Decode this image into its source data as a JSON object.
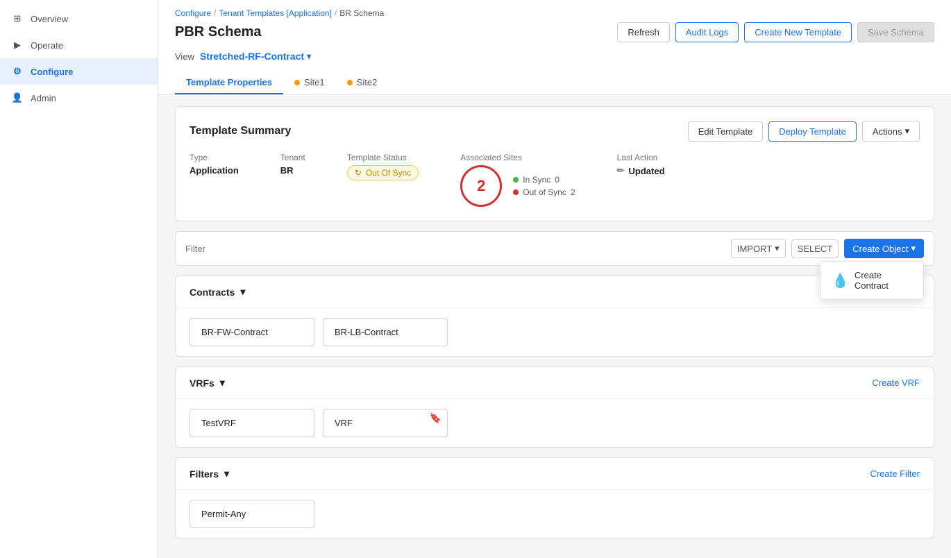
{
  "sidebar": {
    "items": [
      {
        "id": "overview",
        "label": "Overview",
        "icon": "⊞",
        "active": false
      },
      {
        "id": "operate",
        "label": "Operate",
        "icon": "▶",
        "active": false
      },
      {
        "id": "configure",
        "label": "Configure",
        "icon": "⚙",
        "active": true
      },
      {
        "id": "admin",
        "label": "Admin",
        "icon": "👤",
        "active": false
      }
    ]
  },
  "breadcrumb": {
    "items": [
      "Configure",
      "Tenant Templates [Application]",
      "BR Schema"
    ],
    "separators": [
      "/",
      "/"
    ]
  },
  "header": {
    "title": "PBR Schema",
    "buttons": {
      "refresh": "Refresh",
      "audit_logs": "Audit Logs",
      "create_new_template": "Create New Template",
      "save_schema": "Save Schema"
    }
  },
  "view": {
    "label": "View",
    "selected": "Stretched-RF-Contract"
  },
  "tabs": [
    {
      "id": "template-properties",
      "label": "Template Properties",
      "dot": null,
      "active": true
    },
    {
      "id": "site1",
      "label": "Site1",
      "dot": "#ff9800",
      "active": false
    },
    {
      "id": "site2",
      "label": "Site2",
      "dot": "#ff9800",
      "active": false
    }
  ],
  "template_summary": {
    "title": "Template Summary",
    "buttons": {
      "edit_template": "Edit Template",
      "deploy_template": "Deploy Template",
      "actions": "Actions"
    },
    "fields": {
      "type": {
        "label": "Type",
        "value": "Application"
      },
      "tenant": {
        "label": "Tenant",
        "value": "BR"
      },
      "template_status": {
        "label": "Template Status",
        "value": "Out Of Sync",
        "badge_style": "warning"
      },
      "associated_sites": {
        "label": "Associated Sites",
        "count": 2,
        "in_sync": {
          "label": "In Sync",
          "count": 0,
          "color": "#4caf50"
        },
        "out_of_sync": {
          "label": "Out of Sync",
          "count": 2,
          "color": "#d32f2f"
        }
      },
      "last_action": {
        "label": "Last Action",
        "value": "Updated"
      }
    }
  },
  "filter": {
    "placeholder": "Filter",
    "import_label": "IMPORT",
    "select_label": "SELECT",
    "create_object_label": "Create Object"
  },
  "dropdown_menu": {
    "items": [
      {
        "label": "Create Contract",
        "icon": "💧"
      }
    ]
  },
  "sections": [
    {
      "id": "contracts",
      "title": "Contracts",
      "action": "Create Contract",
      "items": [
        {
          "label": "BR-FW-Contract",
          "bookmark": false
        },
        {
          "label": "BR-LB-Contract",
          "bookmark": false
        }
      ]
    },
    {
      "id": "vrfs",
      "title": "VRFs",
      "action": "Create VRF",
      "items": [
        {
          "label": "TestVRF",
          "bookmark": false
        },
        {
          "label": "VRF",
          "bookmark": true
        }
      ]
    },
    {
      "id": "filters",
      "title": "Filters",
      "action": "Create Filter",
      "items": [
        {
          "label": "Permit-Any",
          "bookmark": false
        }
      ]
    }
  ]
}
